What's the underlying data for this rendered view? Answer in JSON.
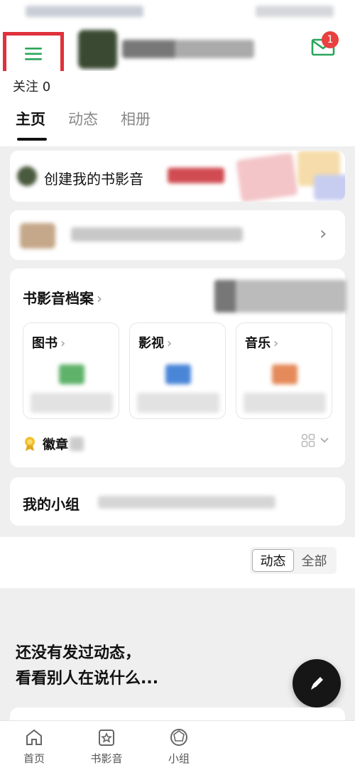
{
  "header": {
    "mail_badge": "1"
  },
  "profile": {
    "follow_label": "关注 0"
  },
  "tabs": [
    {
      "label": "主页",
      "active": true
    },
    {
      "label": "动态",
      "active": false
    },
    {
      "label": "相册",
      "active": false
    }
  ],
  "create_card": {
    "label": "创建我的书影音"
  },
  "archive": {
    "title": "书影音档案",
    "categories": [
      {
        "label": "图书",
        "icon": "book-icon"
      },
      {
        "label": "影视",
        "icon": "movie-icon"
      },
      {
        "label": "音乐",
        "icon": "music-icon"
      }
    ],
    "badge_label": "徽章"
  },
  "groups": {
    "title": "我的小组"
  },
  "filter": {
    "options": [
      "动态",
      "全部"
    ],
    "selected": "动态"
  },
  "empty_state": {
    "line1": "还没有发过动态，",
    "line2": "看看别人在说什么..."
  },
  "bottom_nav": [
    {
      "label": "首页",
      "icon": "home-icon"
    },
    {
      "label": "书影音",
      "icon": "star-card-icon"
    },
    {
      "label": "小组",
      "icon": "group-icon"
    }
  ],
  "colors": {
    "accent": "#2aa55a",
    "highlight": "#e0313c",
    "badge": "#e94040"
  }
}
